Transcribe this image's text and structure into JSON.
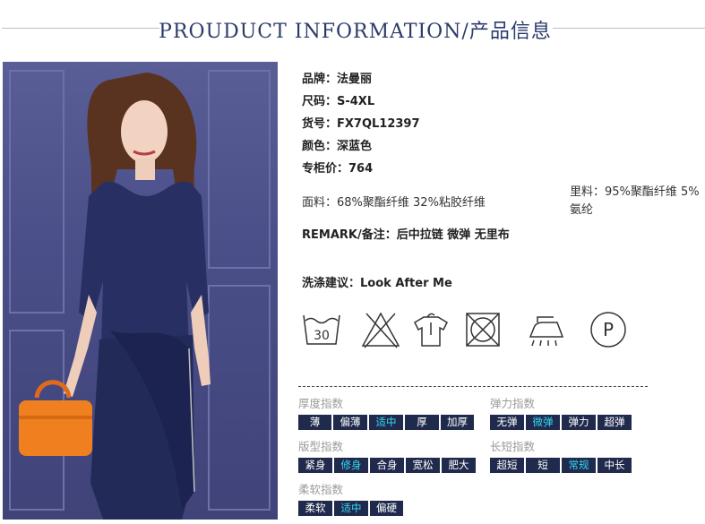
{
  "header": {
    "title": "PROUDUCT INFORMATION/产品信息"
  },
  "specs": {
    "brand": "品牌：法曼丽",
    "size": "尺码：S-4XL",
    "item_no": "货号：FX7QL12397",
    "color": "颜色：深蓝色",
    "price": "专柜价：764",
    "fabric": "面料：68%聚酯纤维 32%粘胶纤维",
    "lining": "里料：95%聚酯纤维 5%氨纶",
    "remark": "REMARK/备注：后中拉链 微弹 无里布",
    "wash": "洗涤建议：Look After Me"
  },
  "care_icons": [
    "wash-30-icon",
    "no-bleach-icon",
    "hang-dry-icon",
    "no-tumble-dry-icon",
    "iron-steam-icon",
    "dry-clean-p-icon"
  ],
  "care_labels": {
    "wash_temp": "30",
    "dry_clean": "P"
  },
  "indices": {
    "thickness": {
      "title": "厚度指数",
      "options": [
        "薄",
        "偏薄",
        "适中",
        "厚",
        "加厚"
      ],
      "selected": "适中"
    },
    "elasticity": {
      "title": "弹力指数",
      "options": [
        "无弹",
        "微弹",
        "弹力",
        "超弹"
      ],
      "selected": "微弹"
    },
    "fit": {
      "title": "版型指数",
      "options": [
        "紧身",
        "修身",
        "合身",
        "宽松",
        "肥大"
      ],
      "selected": "修身"
    },
    "length": {
      "title": "长短指数",
      "options": [
        "超短",
        "短",
        "常规",
        "中长"
      ],
      "selected": "常规"
    },
    "softness": {
      "title": "柔软指数",
      "options": [
        "柔软",
        "适中",
        "偏硬"
      ],
      "selected": "适中"
    }
  },
  "colors": {
    "accent": "#33d8f4",
    "chip_bg": "#202a4c",
    "title": "#2b3a6b"
  }
}
